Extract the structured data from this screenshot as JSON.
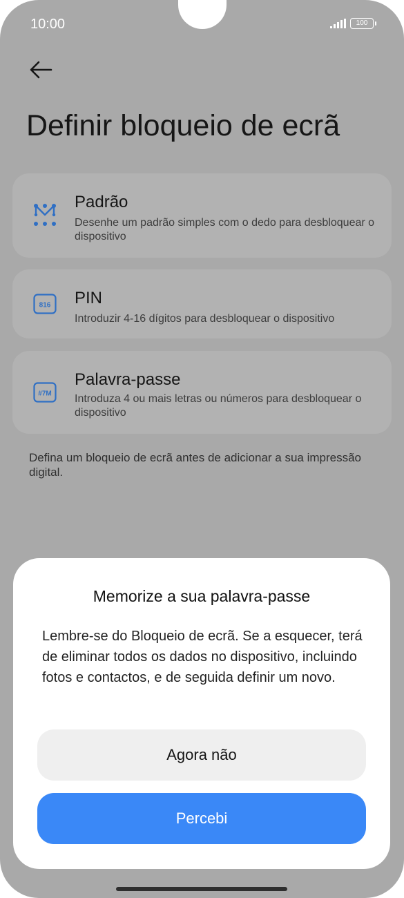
{
  "status_bar": {
    "time": "10:00",
    "battery": "100"
  },
  "header": {
    "title": "Definir bloqueio de ecrã"
  },
  "options": [
    {
      "title": "Padrão",
      "description": "Desenhe um padrão simples com o dedo para desbloquear o dispositivo",
      "icon": "pattern-icon"
    },
    {
      "title": "PIN",
      "description": "Introduzir 4-16 dígitos para desbloquear o dispositivo",
      "icon": "pin-icon",
      "icon_text": "816"
    },
    {
      "title": "Palavra-passe",
      "description": "Introduza 4 ou mais letras ou números para desbloquear o dispositivo",
      "icon": "password-icon",
      "icon_text": "#7M"
    }
  ],
  "note": "Defina um bloqueio de ecrã antes de adicionar a sua impressão digital.",
  "dialog": {
    "title": "Memorize a sua palavra-passe",
    "body": "Lembre-se do Bloqueio de ecrã. Se a esquecer, terá de eliminar todos os dados no dispositivo, incluindo fotos e contactos, e de seguida definir um novo.",
    "secondary_button": "Agora não",
    "primary_button": "Percebi"
  },
  "colors": {
    "accent": "#3a88f7",
    "icon_blue": "#2f6fc4",
    "overlay": "#a9a9a9"
  }
}
